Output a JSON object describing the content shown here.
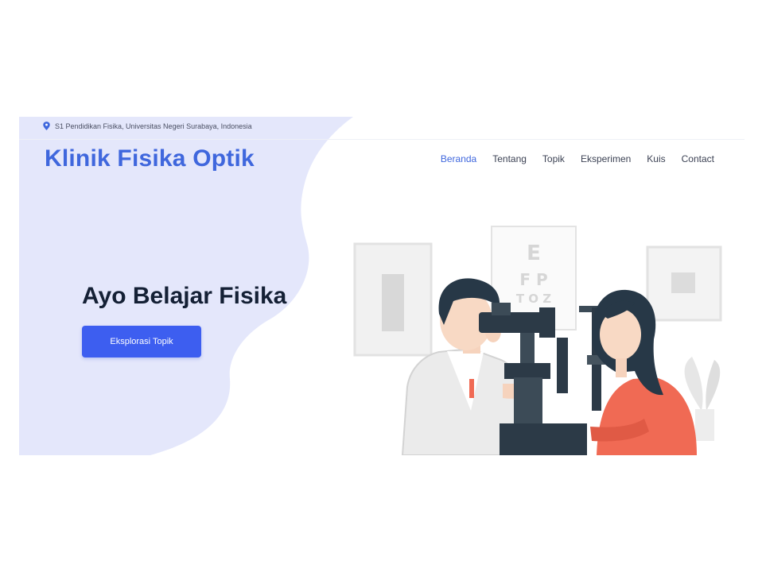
{
  "topbar": {
    "location": "S1 Pendidikan Fisika, Universitas Negeri Surabaya, Indonesia",
    "location_icon": "map-pin-icon"
  },
  "header": {
    "logo": "Klinik Fisika Optik",
    "nav": [
      {
        "label": "Beranda",
        "active": true
      },
      {
        "label": "Tentang",
        "active": false
      },
      {
        "label": "Topik",
        "active": false
      },
      {
        "label": "Eksperimen",
        "active": false
      },
      {
        "label": "Kuis",
        "active": false
      },
      {
        "label": "Contact",
        "active": false
      }
    ]
  },
  "hero": {
    "title": "Ayo Belajar Fisika",
    "button_label": "Eksplorasi Topik",
    "illustration": "optometrist-eye-exam-illustration",
    "eye_chart": [
      "E",
      "F P",
      "T O Z"
    ]
  },
  "colors": {
    "accent": "#3f67dd",
    "button": "#3d5ef0",
    "blob": "#e4e7fb",
    "heading": "#142035",
    "patient_shirt": "#f06a54"
  }
}
